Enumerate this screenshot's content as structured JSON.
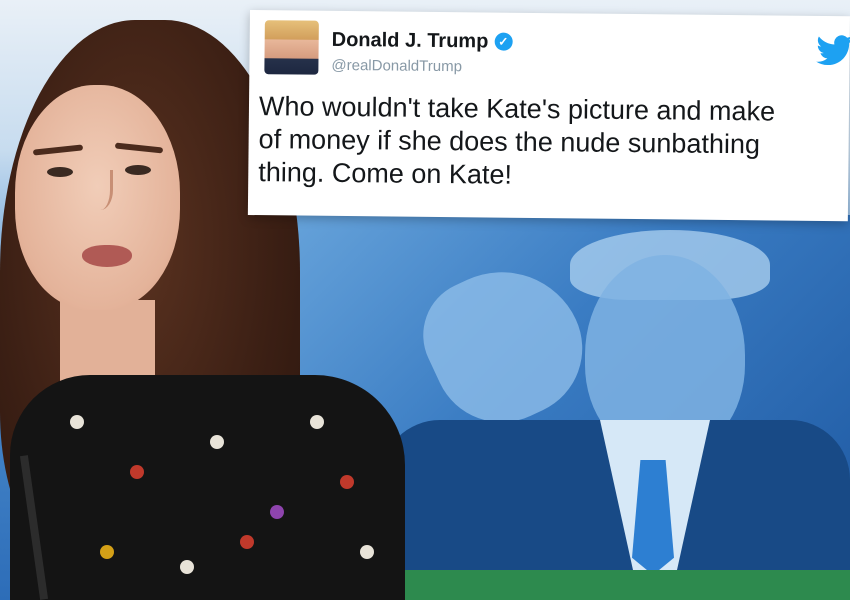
{
  "tweet": {
    "display_name": "Donald J. Trump",
    "verified_icon": "verified-badge-icon",
    "handle": "@realDonaldTrump",
    "text": "Who wouldn't take Kate's picture and make\nof money if she does the nude sunbathing\nthing. Come on Kate!",
    "platform_icon": "twitter-bird-icon"
  },
  "colors": {
    "twitter_blue": "#1da1f2",
    "background_blue": "#3a7cc3",
    "footer_green": "#2d8a4e"
  }
}
